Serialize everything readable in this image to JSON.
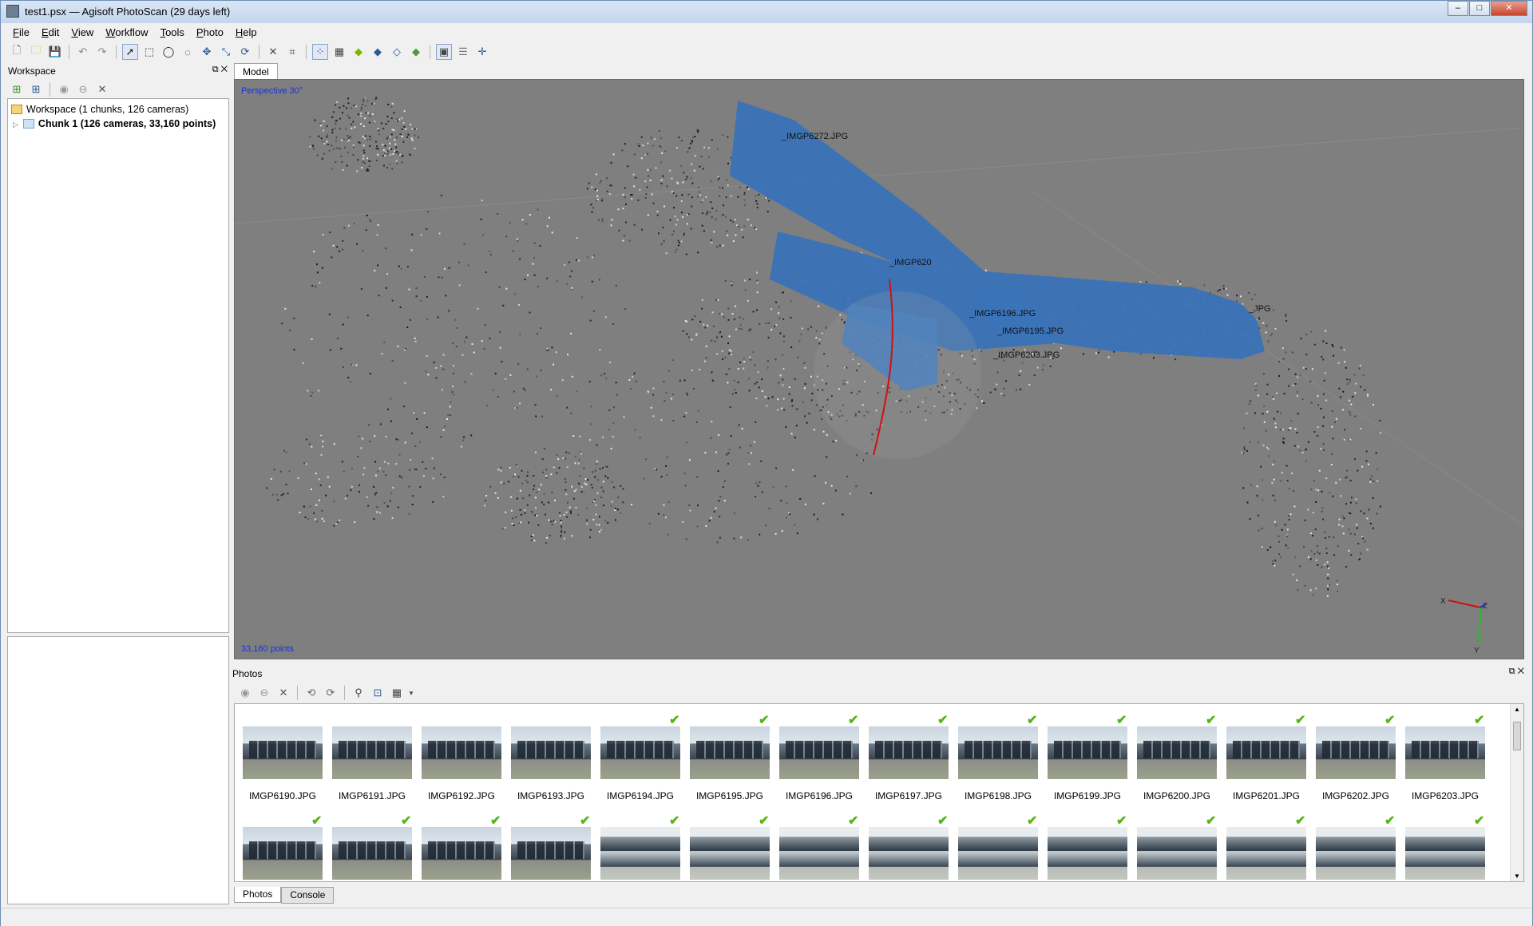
{
  "window": {
    "title": "test1.psx — Agisoft PhotoScan (29 days left)"
  },
  "menu": [
    {
      "key": "F",
      "rest": "ile"
    },
    {
      "key": "E",
      "rest": "dit"
    },
    {
      "key": "V",
      "rest": "iew"
    },
    {
      "key": "W",
      "rest": "orkflow"
    },
    {
      "key": "T",
      "rest": "ools"
    },
    {
      "key": "P",
      "rest": "hoto"
    },
    {
      "key": "H",
      "rest": "elp"
    }
  ],
  "workspace": {
    "panel_title": "Workspace",
    "root_label": "Workspace (1 chunks, 126 cameras)",
    "chunk_label": "Chunk 1 (126 cameras, 33,160 points)"
  },
  "model": {
    "tab_label": "Model",
    "projection": "Perspective 30°",
    "point_count": "33,160 points",
    "axis_labels": {
      "x": "X",
      "y": "Y",
      "z": "Z"
    },
    "camera_labels": [
      "_IMGP6272.JPG",
      "_IMGP620",
      "_IMGP6196.JPG",
      "_IMGP6195.JPG",
      "_IMGP6203.JPG",
      "_JPG"
    ]
  },
  "photos": {
    "panel_title": "Photos",
    "tabs": [
      "Photos",
      "Console"
    ],
    "row1": [
      {
        "name": "IMGP6190.JPG",
        "aligned": false
      },
      {
        "name": "IMGP6191.JPG",
        "aligned": false
      },
      {
        "name": "IMGP6192.JPG",
        "aligned": false
      },
      {
        "name": "IMGP6193.JPG",
        "aligned": false
      },
      {
        "name": "IMGP6194.JPG",
        "aligned": true
      },
      {
        "name": "IMGP6195.JPG",
        "aligned": true
      },
      {
        "name": "IMGP6196.JPG",
        "aligned": true
      },
      {
        "name": "IMGP6197.JPG",
        "aligned": true
      },
      {
        "name": "IMGP6198.JPG",
        "aligned": true
      },
      {
        "name": "IMGP6199.JPG",
        "aligned": true
      },
      {
        "name": "IMGP6200.JPG",
        "aligned": true
      },
      {
        "name": "IMGP6201.JPG",
        "aligned": true
      },
      {
        "name": "IMGP6202.JPG",
        "aligned": true
      },
      {
        "name": "IMGP6203.JPG",
        "aligned": true
      }
    ],
    "row2_aligned": [
      true,
      true,
      true,
      true,
      true,
      true,
      true,
      true,
      true,
      true,
      true,
      true,
      true,
      true
    ]
  },
  "colors": {
    "viewport_bg": "#7f7f7f",
    "camera_planes": "#3a73b8",
    "overlay_text": "#1a33d1",
    "check": "#55b517"
  }
}
